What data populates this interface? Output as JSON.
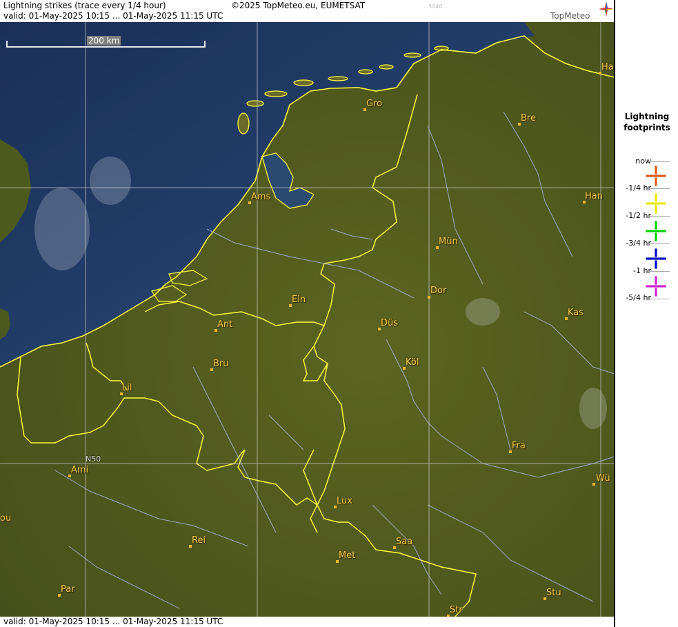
{
  "header": {
    "title": "Lightning strikes (trace every 1/4 hour)",
    "copyright": "©2025 TopMeteo.eu, EUMETSAT",
    "code": "3040",
    "valid": "valid:  01-May-2025 10:15 ... 01-May-2025 11:15 UTC",
    "brand": "TopMeteo"
  },
  "map": {
    "scale_label": "200 km",
    "lat_label": "N50",
    "cities": [
      {
        "label": "Gro"
      },
      {
        "label": "Bre"
      },
      {
        "label": "Ha"
      },
      {
        "label": "Ams"
      },
      {
        "label": "Han"
      },
      {
        "label": "Mün"
      },
      {
        "label": "Dor"
      },
      {
        "label": "Ein"
      },
      {
        "label": "Ant"
      },
      {
        "label": "Düs"
      },
      {
        "label": "Kas"
      },
      {
        "label": "Köl"
      },
      {
        "label": "Bru"
      },
      {
        "label": "Lil"
      },
      {
        "label": "Fra"
      },
      {
        "label": "Ami"
      },
      {
        "label": "Wü"
      },
      {
        "label": "Lux"
      },
      {
        "label": "ou"
      },
      {
        "label": "Rei"
      },
      {
        "label": "Saa"
      },
      {
        "label": "Met"
      },
      {
        "label": "Par"
      },
      {
        "label": "Stu"
      },
      {
        "label": "Str"
      }
    ]
  },
  "legend": {
    "title_line1": "Lightning",
    "title_line2": "footprints",
    "items": [
      {
        "label": "now",
        "color": "#e05a1a"
      },
      {
        "label": "-1/4 hr",
        "color": "#e8e800"
      },
      {
        "label": "-1/2 hr",
        "color": "#00d000"
      },
      {
        "label": "-3/4 hr",
        "color": "#0000c8"
      },
      {
        "label": "-1 hr",
        "color": "#d020d0"
      },
      {
        "label": "-5/4 hr",
        "color": ""
      }
    ]
  },
  "footer": {
    "valid": "valid:  01-May-2025 10:15 ... 01-May-2025 11:15 UTC"
  },
  "colors": {
    "sea": "#1f3a63",
    "land": "#4f5a1a",
    "border": "#ffff3c",
    "river": "#b9c4ea",
    "grid": "#c8c8c8",
    "city": "#f5c94a"
  }
}
